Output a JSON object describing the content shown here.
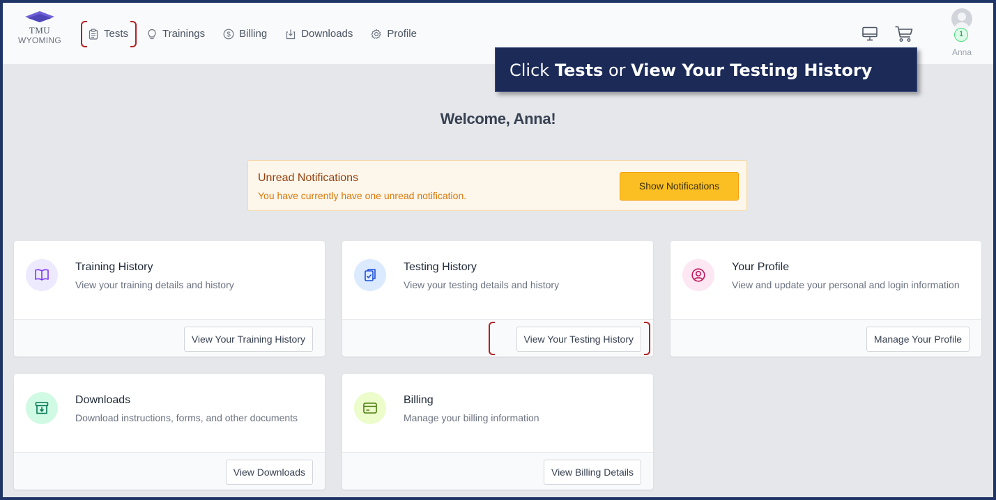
{
  "logo": {
    "line1": "TMU",
    "line2": "WYOMING"
  },
  "nav": [
    {
      "label": "Tests",
      "icon": "clipboard-icon"
    },
    {
      "label": "Trainings",
      "icon": "lightbulb-icon"
    },
    {
      "label": "Billing",
      "icon": "dollar-circle-icon"
    },
    {
      "label": "Downloads",
      "icon": "download-box-icon"
    },
    {
      "label": "Profile",
      "icon": "gear-icon"
    }
  ],
  "user": {
    "name": "Anna",
    "badge_count": "1"
  },
  "callout": {
    "prefix": "Click ",
    "bold1": "Tests",
    "middle": " or ",
    "bold2": "View Your Testing History"
  },
  "welcome": "Welcome, Anna!",
  "notification": {
    "title": "Unread Notifications",
    "message": "You have currently have one unread notification.",
    "button": "Show Notifications"
  },
  "cards": [
    {
      "title": "Training History",
      "desc": "View your training details and history",
      "button": "View Your Training History",
      "icon": "book-icon",
      "icon_bg": "#ede9fe",
      "icon_color": "#7c3aed"
    },
    {
      "title": "Testing History",
      "desc": "View your testing details and history",
      "button": "View Your Testing History",
      "icon": "clipboard-check-icon",
      "icon_bg": "#dbeafe",
      "icon_color": "#1d4ed8"
    },
    {
      "title": "Your Profile",
      "desc": "View and update your personal and login information",
      "button": "Manage Your Profile",
      "icon": "user-circle-icon",
      "icon_bg": "#fce7f3",
      "icon_color": "#be185d"
    },
    {
      "title": "Downloads",
      "desc": "Download instructions, forms, and other documents",
      "button": "View Downloads",
      "icon": "archive-download-icon",
      "icon_bg": "#d1fae5",
      "icon_color": "#047857"
    },
    {
      "title": "Billing",
      "desc": "Manage your billing information",
      "button": "View Billing Details",
      "icon": "credit-card-icon",
      "icon_bg": "#ecfccb",
      "icon_color": "#4d7c0f"
    }
  ],
  "colors": {
    "accent": "#fbbf24",
    "callout_bg": "#1b2a57",
    "highlight_bracket": "#b32025",
    "frame": "#1f3566"
  }
}
